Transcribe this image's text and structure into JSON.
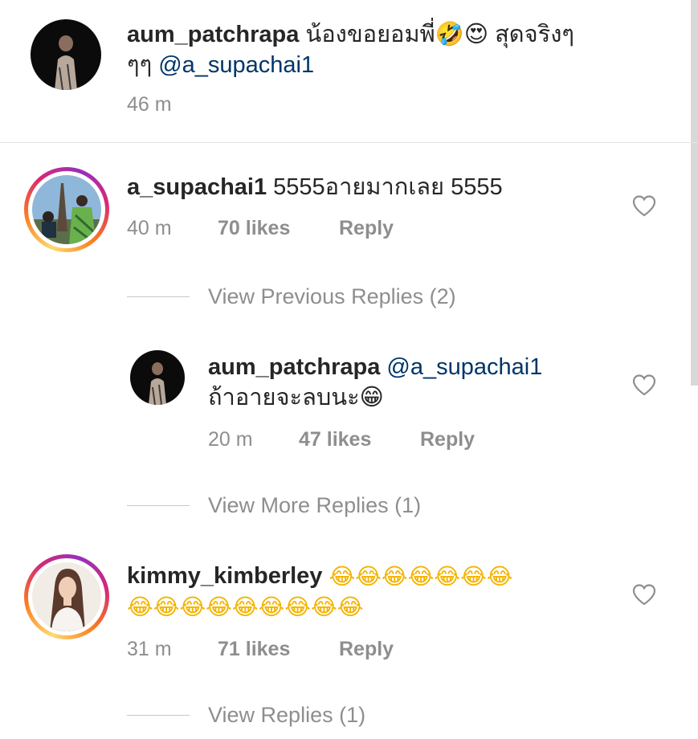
{
  "caption": {
    "username": "aum_patchrapa",
    "text_line1": "น้องขอยอมพี่🤣😍 สุดจริงๆ",
    "text_line2": "ๆๆ",
    "mention": "@a_supachai1",
    "time": "46 m"
  },
  "comments": [
    {
      "username": "a_supachai1",
      "text": "5555อายมากเลย 5555",
      "time": "40 m",
      "likes": "70 likes",
      "reply_label": "Reply"
    }
  ],
  "view_previous": "View Previous Replies (2)",
  "reply": {
    "username": "aum_patchrapa",
    "mention": "@a_supachai1",
    "text": "ถ้าอายจะลบนะ😁",
    "time": "20 m",
    "likes": "47 likes",
    "reply_label": "Reply"
  },
  "view_more": "View More Replies (1)",
  "comment2": {
    "username": "kimmy_kimberley",
    "emoji_line1": "😂😂😂😂😂😂😂",
    "emoji_line2": "😂😂😂😂😂😂😂😂😂",
    "time": "31 m",
    "likes": "71 likes",
    "reply_label": "Reply"
  },
  "view_replies": "View Replies (1)",
  "icons": {
    "like": "heart-outline-icon"
  },
  "colors": {
    "text": "#262626",
    "secondary": "#8e8e8e",
    "mention": "#003569"
  }
}
